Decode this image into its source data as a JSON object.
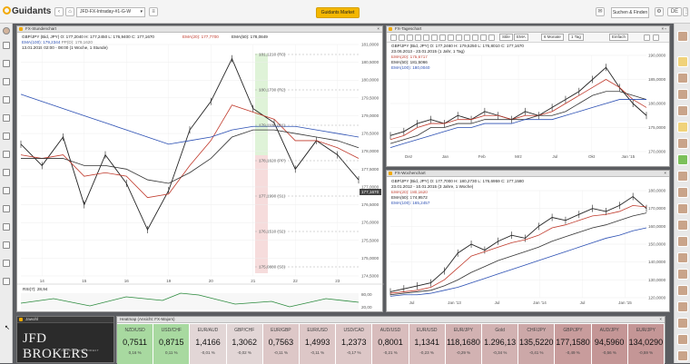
{
  "topbar": {
    "logo_text": "Guidants",
    "workspace": "JFD-FX-Intraday-#1-G-W",
    "market_button": "Guidants Market",
    "search_button": "Suchen & Finden",
    "language": "DE"
  },
  "chart_h1": {
    "title": "FX-Stundenchart",
    "quote": "GBP/JPY (Bid, JPY)  O: 177,2040  H: 177,2450  L: 176,9400  C: 177,1670",
    "ema20": "EMA(20): 177,7700",
    "ema50": "EMA(50): 178,0849",
    "ema100": "EMA(100): 179,2344",
    "pp": "PP(D): 179,1620",
    "period": "13.01.2015 02:00 - 08:00 (1 Woche, 1 Stunde)",
    "price_ticks": [
      "181,0000",
      "180,5000",
      "180,0000",
      "179,5000",
      "179,0000",
      "178,5000",
      "178,0000",
      "177,5000",
      "177,0000",
      "176,5000",
      "176,0000",
      "175,5000",
      "175,0000",
      "174,5000"
    ],
    "price_tag": "177,1670",
    "pivot_labels": [
      "181,1210 (R3)",
      "180,1730 (R2)",
      "179,1100 (R1)",
      "178,1620 (PP)",
      "177,1990 (S1)",
      "176,1510 (S2)",
      "175,0880 (S3)"
    ],
    "time_ticks": [
      "14",
      "15",
      "16",
      "19",
      "20",
      "21",
      "22",
      "23"
    ],
    "rsi_label": "RSI(7): 28,94",
    "rsi_ticks": [
      "80,00",
      "20,00"
    ]
  },
  "chart_d1": {
    "title": "FX-Tageschart",
    "toolbar": [
      "Stile",
      "EMA",
      "6 Monate",
      "1 Tag",
      "Einfach"
    ],
    "quote": "GBP/JPY (Bid, JPY)  O: 177,2460  H: 179,5250  L: 176,8010  C: 177,1670",
    "period": "23.06.2013 - 23.01.2015 (1 Jahr, 1 Tag)",
    "ema20": "EMA(20): 175,6717",
    "ema50": "EMA(50): 181,5066",
    "ema100": "EMA(100): 180,0040",
    "price_ticks": [
      "190,0000",
      "185,0000",
      "180,0000",
      "175,0000",
      "170,0000"
    ],
    "time_ticks": [
      "Dez",
      "Jan",
      "Feb",
      "Mrz",
      "Jul",
      "Okt",
      "Jan '15"
    ]
  },
  "chart_w1": {
    "title": "FX-Wochenchart",
    "quote": "GBP/JPY (Bid, JPY)  O: 177,7000  H: 180,2730  L: 176,6959  C: 177,1580",
    "period": "23.01.2012 - 10.01.2015 (3 Jahre, 1 Woche)",
    "ema20": "EMA(20): 180,1620",
    "ema50": "EMA(50): 174,9572",
    "ema100": "EMA(100): 165,2457",
    "price_ticks": [
      "180,0000",
      "170,0000",
      "160,0000",
      "150,0000",
      "140,0000",
      "130,0000",
      "120,0000"
    ],
    "time_ticks": [
      "Jul",
      "Jan '13",
      "Jul",
      "Jan '14",
      "Jul",
      "Jan '15"
    ]
  },
  "news": {
    "title": "Jawohl",
    "brand": "JFD BROKERS",
    "tagline": "JUST FAIR AND DIRECT"
  },
  "heatmap": {
    "title": "Heatmap (Ansicht: FX-Majors)",
    "cells": [
      {
        "name": "NZD/USD",
        "value": "0,7511",
        "pct": "0,16 %",
        "color": "#a8d9a0"
      },
      {
        "name": "USD/CHF",
        "value": "0,8715",
        "pct": "0,11 %",
        "color": "#a8d9a0"
      },
      {
        "name": "EUR/AUD",
        "value": "1,4166",
        "pct": "-0,01 %",
        "color": "#e2d6d6"
      },
      {
        "name": "GBP/CHF",
        "value": "1,3062",
        "pct": "-0,02 %",
        "color": "#e2d6d6"
      },
      {
        "name": "EUR/GBP",
        "value": "0,7563",
        "pct": "-0,11 %",
        "color": "#ddc7c7"
      },
      {
        "name": "EUR/USD",
        "value": "1,4993",
        "pct": "-0,11 %",
        "color": "#ddc7c7"
      },
      {
        "name": "USD/CAD",
        "value": "1,2373",
        "pct": "-0,17 %",
        "color": "#ddc7c7"
      },
      {
        "name": "AUD/USD",
        "value": "0,8001",
        "pct": "-0,21 %",
        "color": "#d8bcbc"
      },
      {
        "name": "EUR/USD",
        "value": "1,1341",
        "pct": "-0,23 %",
        "color": "#d8bcbc"
      },
      {
        "name": "EUR/JPY",
        "value": "118,1680",
        "pct": "-0,29 %",
        "color": "#d2b2b2"
      },
      {
        "name": "Gold",
        "value": "1.296,13",
        "pct": "-0,34 %",
        "color": "#d2b2b2"
      },
      {
        "name": "CHF/JPY",
        "value": "135,5220",
        "pct": "-0,41 %",
        "color": "#cca8a8"
      },
      {
        "name": "GBP/JPY",
        "value": "177,1580",
        "pct": "-0,49 %",
        "color": "#c89c9c"
      },
      {
        "name": "AUD/JPY",
        "value": "94,5960",
        "pct": "-0,56 %",
        "color": "#c49696"
      },
      {
        "name": "EUR/JPY",
        "value": "134,0290",
        "pct": "-0,59 %",
        "color": "#c49696"
      }
    ]
  },
  "chart_data": [
    {
      "type": "line",
      "title": "FX-Stundenchart",
      "ylim": [
        174.5,
        181.0
      ],
      "series": [
        {
          "name": "GBP/JPY",
          "values": [
            178.2,
            177.6,
            178.4,
            176.5,
            177.9,
            177.1,
            175.8,
            176.9,
            178.6,
            179.4,
            180.6,
            179.2,
            178.8,
            177.5,
            178.3,
            177.9,
            177.2
          ]
        },
        {
          "name": "EMA(20)",
          "values": [
            177.9,
            177.8,
            177.9,
            177.3,
            177.4,
            177.3,
            176.7,
            176.8,
            177.6,
            178.3,
            179.3,
            179.1,
            178.9,
            178.3,
            178.3,
            178.1,
            177.8
          ]
        },
        {
          "name": "EMA(50)",
          "values": [
            177.8,
            177.8,
            177.8,
            177.6,
            177.6,
            177.5,
            177.2,
            177.1,
            177.4,
            177.8,
            178.4,
            178.6,
            178.6,
            178.5,
            178.4,
            178.3,
            178.1
          ]
        },
        {
          "name": "EMA(100)",
          "values": [
            179.6,
            179.4,
            179.2,
            179.0,
            178.8,
            178.6,
            178.4,
            178.2,
            178.3,
            178.4,
            178.6,
            178.7,
            178.7,
            178.7,
            178.6,
            178.5,
            178.4
          ]
        }
      ]
    },
    {
      "type": "line",
      "title": "FX-Tageschart",
      "ylim": [
        168,
        192
      ],
      "series": [
        {
          "name": "GBP/JPY",
          "values": [
            172,
            173,
            175,
            176,
            175,
            177,
            176,
            178,
            177,
            176,
            178,
            177,
            179,
            181,
            183,
            186,
            189,
            184,
            180,
            177
          ]
        },
        {
          "name": "EMA(20)",
          "values": [
            171,
            172,
            174,
            175,
            175,
            176,
            176,
            177,
            177,
            176,
            177,
            177,
            178,
            180,
            182,
            184,
            186,
            184,
            181,
            179
          ]
        },
        {
          "name": "EMA(50)",
          "values": [
            170,
            171,
            172,
            174,
            174,
            175,
            175,
            176,
            176,
            176,
            176,
            177,
            177,
            178,
            180,
            182,
            183,
            183,
            182,
            181
          ]
        },
        {
          "name": "EMA(100)",
          "values": [
            169,
            170,
            171,
            172,
            173,
            174,
            174,
            175,
            175,
            175,
            176,
            176,
            176,
            177,
            178,
            179,
            180,
            181,
            181,
            181
          ]
        }
      ]
    },
    {
      "type": "line",
      "title": "FX-Wochenchart",
      "ylim": [
        118,
        190
      ],
      "series": [
        {
          "name": "GBP/JPY",
          "values": [
            122,
            124,
            126,
            128,
            136,
            148,
            154,
            150,
            156,
            160,
            158,
            166,
            172,
            170,
            174,
            178,
            176,
            180,
            186,
            178
          ]
        },
        {
          "name": "EMA(20)",
          "values": [
            121,
            122,
            123,
            125,
            130,
            138,
            146,
            149,
            152,
            155,
            157,
            160,
            165,
            167,
            170,
            173,
            174,
            176,
            180,
            179
          ]
        },
        {
          "name": "EMA(50)",
          "values": [
            120,
            121,
            122,
            123,
            126,
            130,
            135,
            139,
            143,
            146,
            149,
            152,
            156,
            159,
            162,
            165,
            167,
            170,
            173,
            175
          ]
        },
        {
          "name": "EMA(100)",
          "values": [
            119,
            120,
            120,
            121,
            123,
            125,
            128,
            131,
            134,
            137,
            140,
            143,
            146,
            149,
            152,
            155,
            158,
            160,
            163,
            165
          ]
        }
      ]
    }
  ]
}
